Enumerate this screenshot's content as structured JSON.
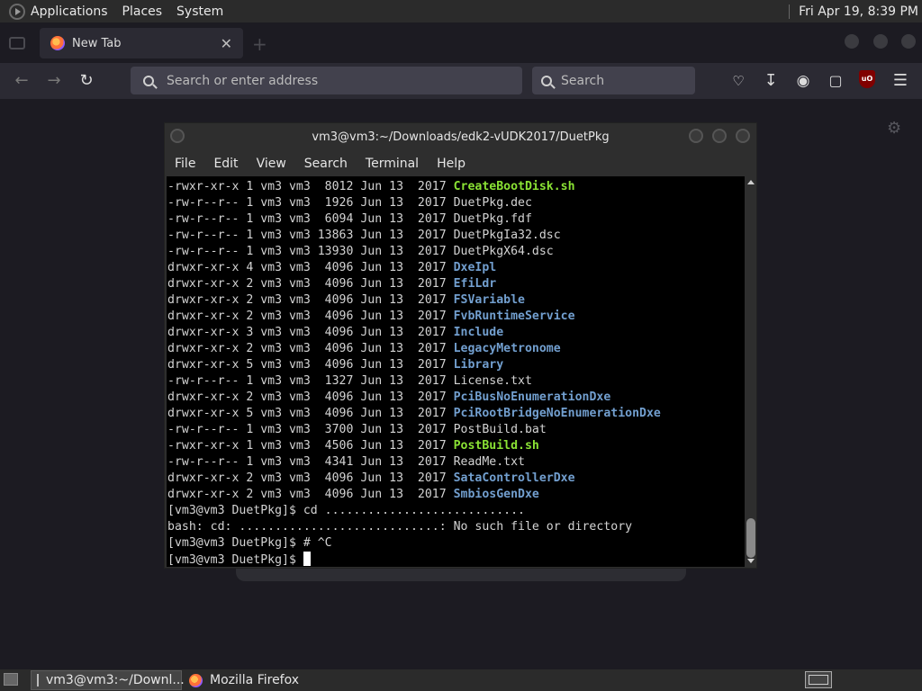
{
  "top_panel": {
    "menus": [
      "Applications",
      "Places",
      "System"
    ],
    "clock": "Fri Apr 19,  8:39 PM"
  },
  "browser": {
    "tab_title": "New Tab",
    "tab_close_glyph": "✕",
    "url_placeholder": "Search or enter address",
    "search_placeholder": "Search",
    "ublock_badge": "uO"
  },
  "terminal": {
    "title": "vm3@vm3:~/Downloads/edk2-vUDK2017/DuetPkg",
    "menu": [
      "File",
      "Edit",
      "View",
      "Search",
      "Terminal",
      "Help"
    ],
    "listing": [
      {
        "prefix": "-rwxr-xr-x 1 vm3 vm3  8012 Jun 13  2017 ",
        "name": "CreateBootDisk.sh",
        "kind": "exec"
      },
      {
        "prefix": "-rw-r--r-- 1 vm3 vm3  1926 Jun 13  2017 ",
        "name": "DuetPkg.dec",
        "kind": "file"
      },
      {
        "prefix": "-rw-r--r-- 1 vm3 vm3  6094 Jun 13  2017 ",
        "name": "DuetPkg.fdf",
        "kind": "file"
      },
      {
        "prefix": "-rw-r--r-- 1 vm3 vm3 13863 Jun 13  2017 ",
        "name": "DuetPkgIa32.dsc",
        "kind": "file"
      },
      {
        "prefix": "-rw-r--r-- 1 vm3 vm3 13930 Jun 13  2017 ",
        "name": "DuetPkgX64.dsc",
        "kind": "file"
      },
      {
        "prefix": "drwxr-xr-x 4 vm3 vm3  4096 Jun 13  2017 ",
        "name": "DxeIpl",
        "kind": "dir"
      },
      {
        "prefix": "drwxr-xr-x 2 vm3 vm3  4096 Jun 13  2017 ",
        "name": "EfiLdr",
        "kind": "dir"
      },
      {
        "prefix": "drwxr-xr-x 2 vm3 vm3  4096 Jun 13  2017 ",
        "name": "FSVariable",
        "kind": "dir"
      },
      {
        "prefix": "drwxr-xr-x 2 vm3 vm3  4096 Jun 13  2017 ",
        "name": "FvbRuntimeService",
        "kind": "dir"
      },
      {
        "prefix": "drwxr-xr-x 3 vm3 vm3  4096 Jun 13  2017 ",
        "name": "Include",
        "kind": "dir"
      },
      {
        "prefix": "drwxr-xr-x 2 vm3 vm3  4096 Jun 13  2017 ",
        "name": "LegacyMetronome",
        "kind": "dir"
      },
      {
        "prefix": "drwxr-xr-x 5 vm3 vm3  4096 Jun 13  2017 ",
        "name": "Library",
        "kind": "dir"
      },
      {
        "prefix": "-rw-r--r-- 1 vm3 vm3  1327 Jun 13  2017 ",
        "name": "License.txt",
        "kind": "file"
      },
      {
        "prefix": "drwxr-xr-x 2 vm3 vm3  4096 Jun 13  2017 ",
        "name": "PciBusNoEnumerationDxe",
        "kind": "dir"
      },
      {
        "prefix": "drwxr-xr-x 5 vm3 vm3  4096 Jun 13  2017 ",
        "name": "PciRootBridgeNoEnumerationDxe",
        "kind": "dir"
      },
      {
        "prefix": "-rw-r--r-- 1 vm3 vm3  3700 Jun 13  2017 ",
        "name": "PostBuild.bat",
        "kind": "file"
      },
      {
        "prefix": "-rwxr-xr-x 1 vm3 vm3  4506 Jun 13  2017 ",
        "name": "PostBuild.sh",
        "kind": "exec"
      },
      {
        "prefix": "-rw-r--r-- 1 vm3 vm3  4341 Jun 13  2017 ",
        "name": "ReadMe.txt",
        "kind": "file"
      },
      {
        "prefix": "drwxr-xr-x 2 vm3 vm3  4096 Jun 13  2017 ",
        "name": "SataControllerDxe",
        "kind": "dir"
      },
      {
        "prefix": "drwxr-xr-x 2 vm3 vm3  4096 Jun 13  2017 ",
        "name": "SmbiosGenDxe",
        "kind": "dir"
      }
    ],
    "output_lines": [
      "[vm3@vm3 DuetPkg]$ cd ............................",
      "bash: cd: ............................: No such file or directory",
      "[vm3@vm3 DuetPkg]$ # ^C"
    ],
    "prompt": "[vm3@vm3 DuetPkg]$ "
  },
  "taskbar": {
    "items": [
      "vm3@vm3:~/Downl...",
      "Mozilla Firefox"
    ]
  },
  "colors": {
    "exec": "#8ae234",
    "dir": "#729fcf",
    "terminal_bg": "#000000"
  }
}
